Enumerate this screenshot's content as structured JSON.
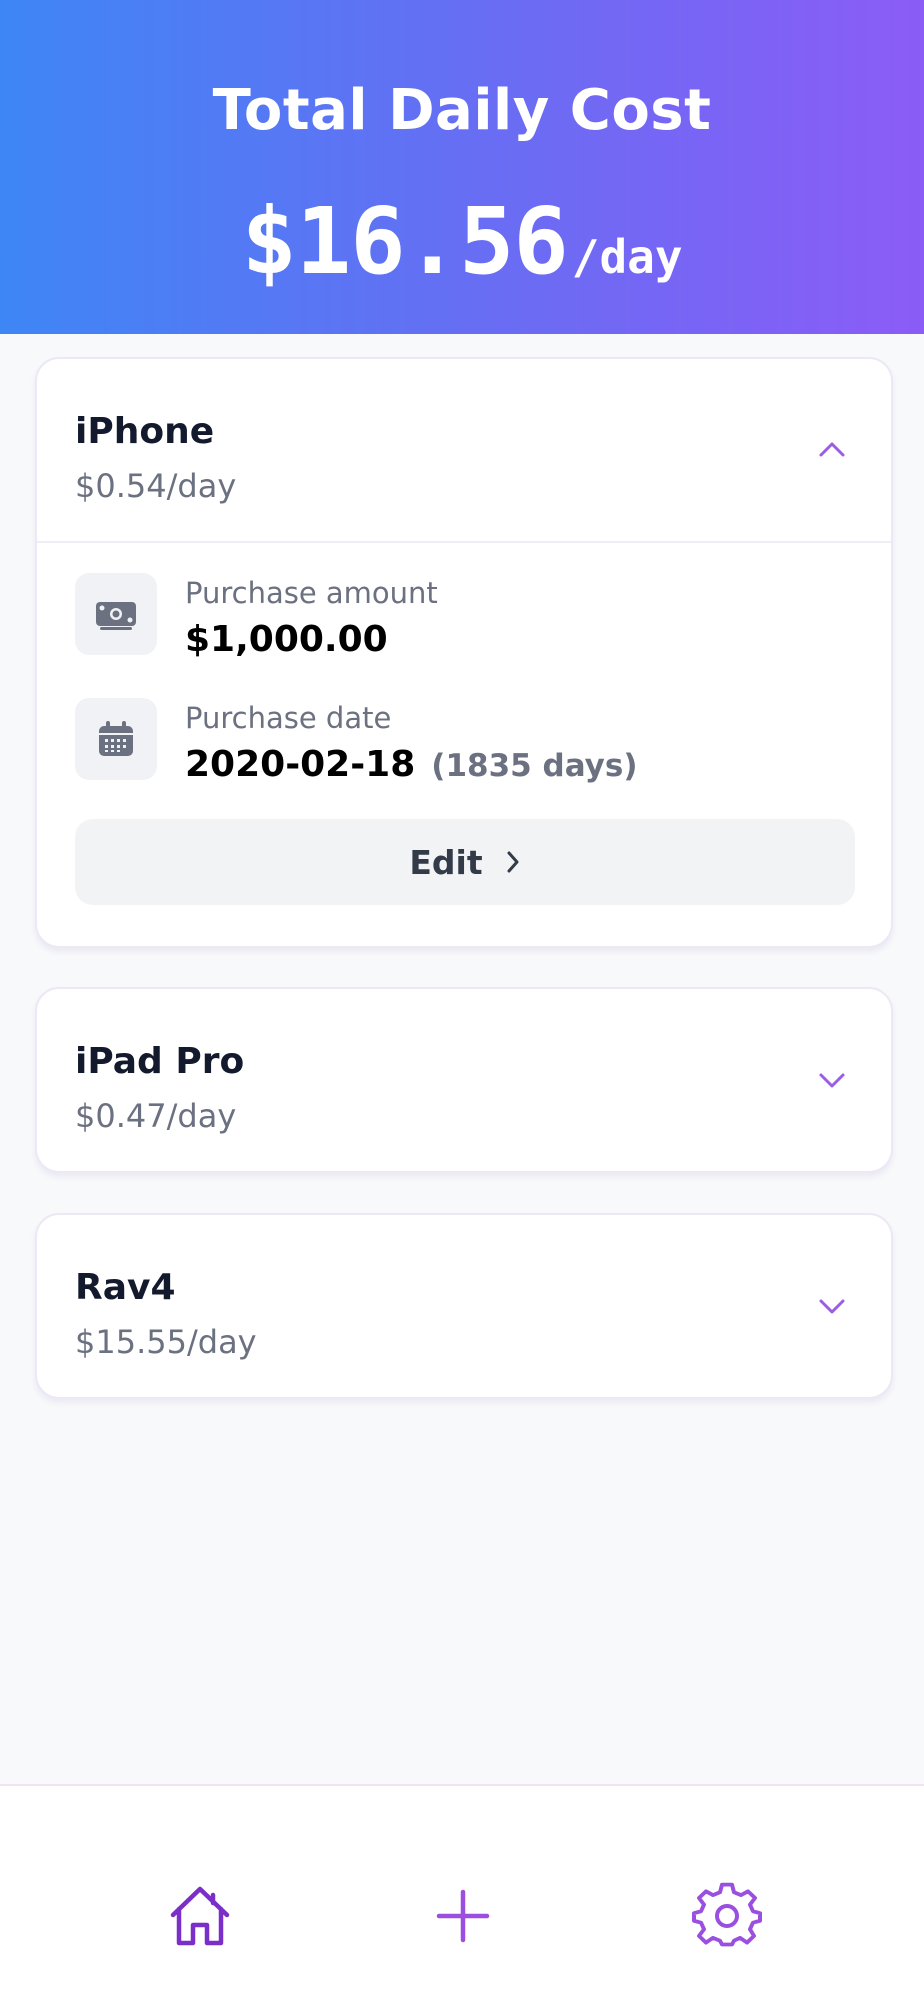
{
  "header": {
    "title": "Total Daily Cost",
    "total_amount": "$16.56",
    "total_unit": "/day"
  },
  "items": [
    {
      "name": "iPhone",
      "rate": "$0.54/day",
      "expanded": true,
      "purchase_amount_label": "Purchase amount",
      "purchase_amount": "$1,000.00",
      "purchase_date_label": "Purchase date",
      "purchase_date": "2020-02-18",
      "days_owned": "(1835 days)",
      "edit_label": "Edit"
    },
    {
      "name": "iPad Pro",
      "rate": "$0.47/day",
      "expanded": false
    },
    {
      "name": "Rav4",
      "rate": "$15.55/day",
      "expanded": false
    }
  ],
  "nav": {
    "items": [
      "home-icon",
      "plus-icon",
      "gear-icon"
    ]
  },
  "colors": {
    "gradient_start": "#3e86f5",
    "gradient_end": "#8b5cf6",
    "accent": "#9b5de5",
    "nav_icon": "#7a2fc9"
  }
}
